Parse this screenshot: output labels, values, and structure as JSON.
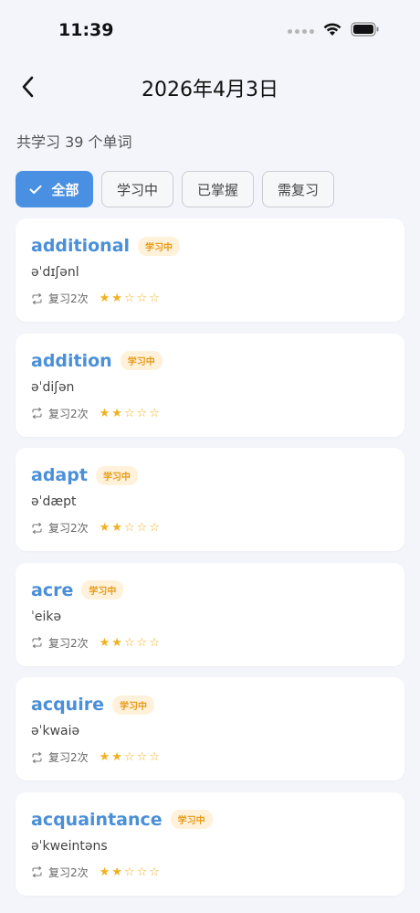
{
  "status_bar": {
    "time": "11:39"
  },
  "header": {
    "title": "2026年4月3日"
  },
  "summary": {
    "text": "共学习 39 个单词"
  },
  "filters": [
    {
      "label": "全部",
      "active": true
    },
    {
      "label": "学习中",
      "active": false
    },
    {
      "label": "已掌握",
      "active": false
    },
    {
      "label": "需复习",
      "active": false
    }
  ],
  "words": [
    {
      "word": "additional",
      "status": "学习中",
      "phonetic": "əˈdɪʃənl",
      "review": "复习2次",
      "stars": 2
    },
    {
      "word": "addition",
      "status": "学习中",
      "phonetic": "əˈdiʃən",
      "review": "复习2次",
      "stars": 2
    },
    {
      "word": "adapt",
      "status": "学习中",
      "phonetic": "əˈdæpt",
      "review": "复习2次",
      "stars": 2
    },
    {
      "word": "acre",
      "status": "学习中",
      "phonetic": "ˈeikə",
      "review": "复习2次",
      "stars": 2
    },
    {
      "word": "acquire",
      "status": "学习中",
      "phonetic": "əˈkwaiə",
      "review": "复习2次",
      "stars": 2
    },
    {
      "word": "acquaintance",
      "status": "学习中",
      "phonetic": "əˈkweintəns",
      "review": "复习2次",
      "stars": 2
    }
  ],
  "colors": {
    "accent": "#4A90E2",
    "badge_bg": "#FFF1DA",
    "badge_text": "#E69A18",
    "star": "#F2B01E",
    "background": "#F3F5FB"
  }
}
